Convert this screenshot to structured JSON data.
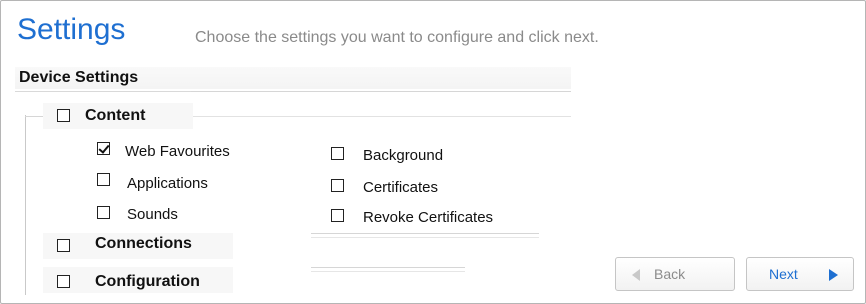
{
  "header": {
    "title": "Settings",
    "subtitle": "Choose the settings you want to configure and click next."
  },
  "section": {
    "label": "Device Settings",
    "groups": [
      {
        "label": "Content",
        "checked": false,
        "options": [
          {
            "label": "Web Favourites",
            "checked": true
          },
          {
            "label": "Applications",
            "checked": false
          },
          {
            "label": "Sounds",
            "checked": false
          },
          {
            "label": "Background",
            "checked": false
          },
          {
            "label": "Certificates",
            "checked": false
          },
          {
            "label": "Revoke Certificates",
            "checked": false
          }
        ]
      },
      {
        "label": "Connections",
        "checked": false
      },
      {
        "label": "Configuration",
        "checked": false
      }
    ]
  },
  "footer": {
    "back_label": "Back",
    "next_label": "Next"
  },
  "colors": {
    "accent": "#1e6fd1",
    "muted_text": "#8a8a8a"
  }
}
